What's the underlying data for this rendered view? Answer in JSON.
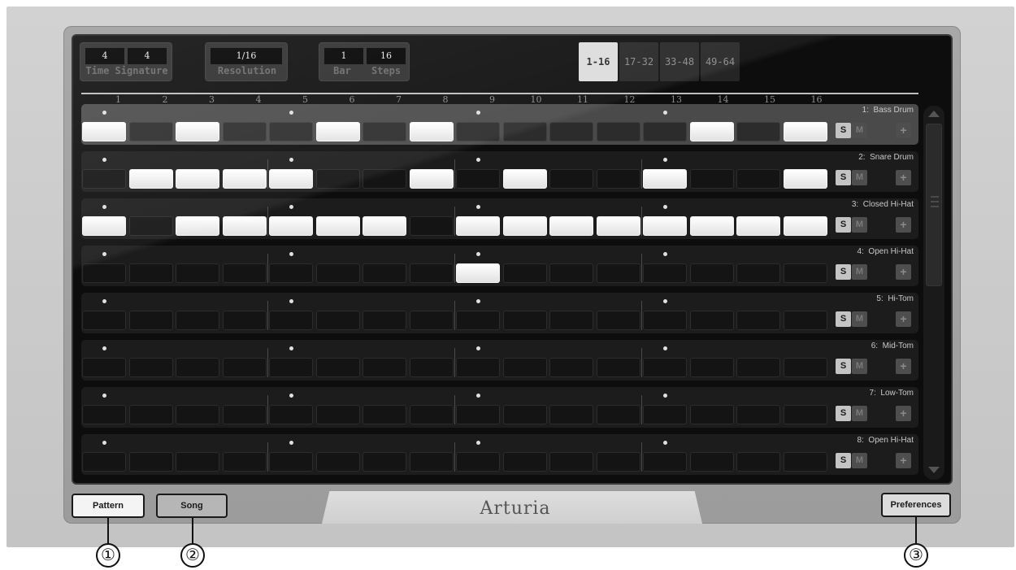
{
  "header": {
    "time_signature": {
      "numerator": "4",
      "denominator": "4",
      "label": "Time Signature"
    },
    "resolution": {
      "value": "1/16",
      "label": "Resolution"
    },
    "bar": {
      "value": "1",
      "label": "Bar"
    },
    "steps": {
      "value": "16",
      "label": "Steps"
    }
  },
  "page_tabs": [
    {
      "label": "1-16",
      "active": true
    },
    {
      "label": "17-32",
      "active": false
    },
    {
      "label": "33-48",
      "active": false
    },
    {
      "label": "49-64",
      "active": false
    }
  ],
  "step_numbers": [
    "1",
    "2",
    "3",
    "4",
    "5",
    "6",
    "7",
    "8",
    "9",
    "10",
    "11",
    "12",
    "13",
    "14",
    "15",
    "16"
  ],
  "tracks": [
    {
      "number": "1:",
      "name": "Bass Drum",
      "selected": true,
      "steps": [
        1,
        0,
        1,
        0,
        0,
        1,
        0,
        1,
        0,
        0,
        0,
        0,
        0,
        1,
        0,
        1
      ]
    },
    {
      "number": "2:",
      "name": "Snare Drum",
      "selected": false,
      "steps": [
        0,
        1,
        1,
        1,
        1,
        0,
        0,
        1,
        0,
        1,
        0,
        0,
        1,
        0,
        0,
        1
      ]
    },
    {
      "number": "3:",
      "name": "Closed Hi-Hat",
      "selected": false,
      "steps": [
        1,
        0,
        1,
        1,
        1,
        1,
        1,
        0,
        1,
        1,
        1,
        1,
        1,
        1,
        1,
        1
      ]
    },
    {
      "number": "4:",
      "name": "Open Hi-Hat",
      "selected": false,
      "steps": [
        0,
        0,
        0,
        0,
        0,
        0,
        0,
        0,
        1,
        0,
        0,
        0,
        0,
        0,
        0,
        0
      ]
    },
    {
      "number": "5:",
      "name": "Hi-Tom",
      "selected": false,
      "steps": [
        0,
        0,
        0,
        0,
        0,
        0,
        0,
        0,
        0,
        0,
        0,
        0,
        0,
        0,
        0,
        0
      ]
    },
    {
      "number": "6:",
      "name": "Mid-Tom",
      "selected": false,
      "steps": [
        0,
        0,
        0,
        0,
        0,
        0,
        0,
        0,
        0,
        0,
        0,
        0,
        0,
        0,
        0,
        0
      ]
    },
    {
      "number": "7:",
      "name": "Low-Tom",
      "selected": false,
      "steps": [
        0,
        0,
        0,
        0,
        0,
        0,
        0,
        0,
        0,
        0,
        0,
        0,
        0,
        0,
        0,
        0
      ]
    },
    {
      "number": "8:",
      "name": "Open Hi-Hat",
      "selected": false,
      "steps": [
        0,
        0,
        0,
        0,
        0,
        0,
        0,
        0,
        0,
        0,
        0,
        0,
        0,
        0,
        0,
        0
      ]
    }
  ],
  "track_buttons": {
    "solo": "S",
    "mute": "M",
    "add": "+"
  },
  "bottom_bar": {
    "pattern_label": "Pattern",
    "song_label": "Song",
    "preferences_label": "Preferences",
    "logo_text": "Arturia"
  },
  "callouts": [
    "①",
    "②",
    "③"
  ],
  "colors": {
    "screen_bg": "#0d0d0d",
    "step_on": "#ffffff",
    "step_off": "#141414"
  }
}
